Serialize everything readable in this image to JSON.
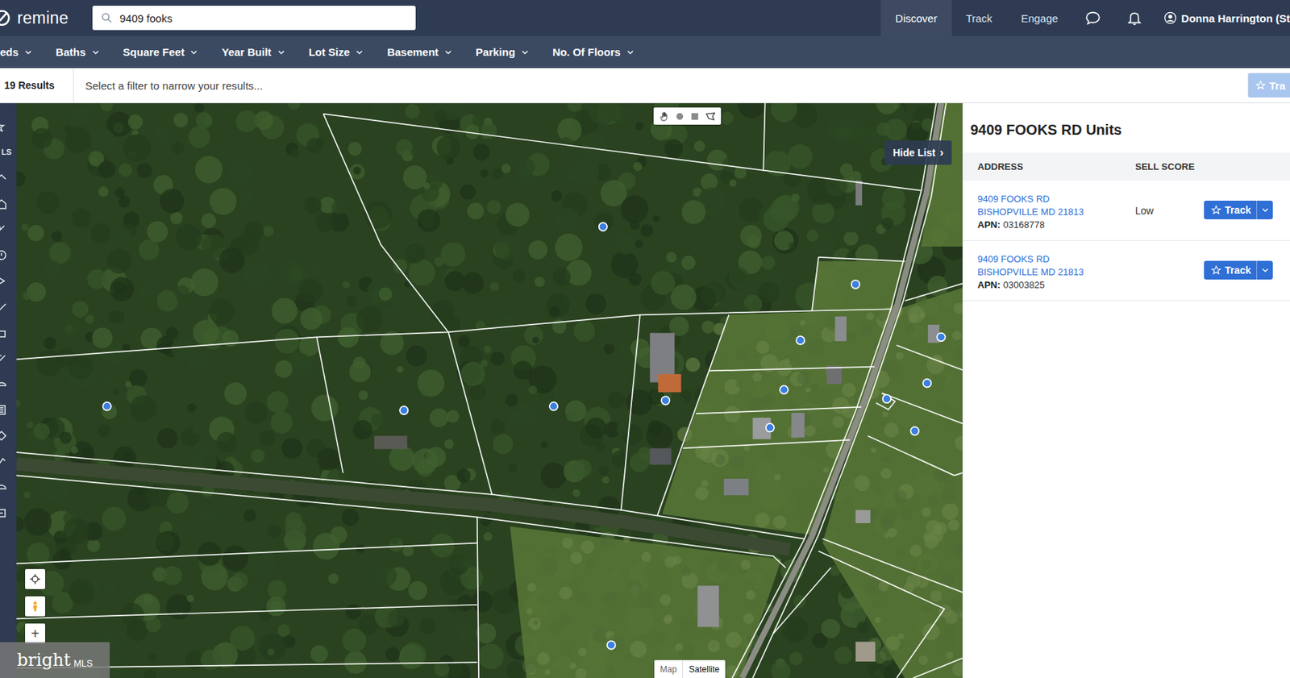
{
  "app": {
    "logo": "remine"
  },
  "search": {
    "value": "9409 fooks"
  },
  "nav": [
    {
      "label": "Discover",
      "selected": true
    },
    {
      "label": "Track",
      "selected": false
    },
    {
      "label": "Engage",
      "selected": false
    }
  ],
  "user": {
    "name": "Donna Harrington (St"
  },
  "filters": [
    "eds",
    "Baths",
    "Square Feet",
    "Year Built",
    "Lot Size",
    "Basement",
    "Parking",
    "No. Of Floors"
  ],
  "results": {
    "count": "19 Results",
    "hint": "Select a filter to narrow your results...",
    "track_all": "Tra"
  },
  "sidebar": {
    "label": "LS"
  },
  "map": {
    "hide_list": "Hide List",
    "hide_list_icon": "›",
    "zoom_in": "+",
    "layers": [
      {
        "label": "Map",
        "selected": false
      },
      {
        "label": "Satellite",
        "selected": true
      }
    ],
    "watermark": {
      "brand": "bright",
      "suffix": "MLS"
    }
  },
  "panel": {
    "title": "9409 FOOKS RD Units",
    "columns": [
      "ADDRESS",
      "SELL SCORE"
    ],
    "rows": [
      {
        "street": "9409 FOOKS RD",
        "city": "BISHOPVILLE MD 21813",
        "apn_label": "APN:",
        "apn": "03168778",
        "sell_score": "Low",
        "action": "Track"
      },
      {
        "street": "9409 FOOKS RD",
        "city": "BISHOPVILLE MD 21813",
        "apn_label": "APN:",
        "apn": "03003825",
        "sell_score": "",
        "action": "Track"
      }
    ]
  }
}
